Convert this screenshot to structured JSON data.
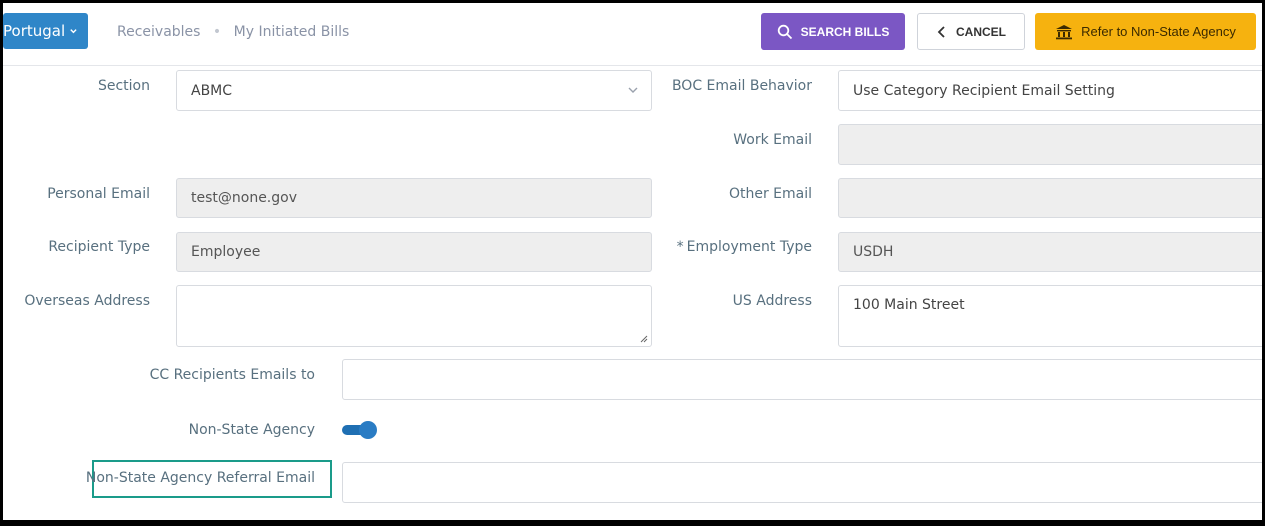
{
  "topbar": {
    "country": "Portugal",
    "breadcrumb": [
      "Receivables",
      "My Initiated Bills"
    ],
    "search_label": "SEARCH BILLS",
    "cancel_label": "CANCEL",
    "refer_label": "Refer to Non-State Agency"
  },
  "colors": {
    "country_button": "#2f86c8",
    "search_button": "#7b57c4",
    "refer_button": "#f6b20f",
    "label": "#58707f",
    "toggle_on": "#1f6fb3",
    "highlight_border": "#1a9b8a"
  },
  "form": {
    "section": {
      "label": "Section",
      "value": "ABMC"
    },
    "boc_email_behavior": {
      "label": "BOC Email Behavior",
      "value": "Use Category Recipient Email Setting"
    },
    "work_email": {
      "label": "Work Email",
      "value": ""
    },
    "personal_email": {
      "label": "Personal Email",
      "value": "test@none.gov"
    },
    "other_email": {
      "label": "Other Email",
      "value": ""
    },
    "recipient_type": {
      "label": "Recipient Type",
      "value": "Employee"
    },
    "employment_type": {
      "label": "Employment Type",
      "required_marker": "*",
      "value": "USDH"
    },
    "overseas_address": {
      "label": "Overseas Address",
      "value": ""
    },
    "us_address": {
      "label": "US Address",
      "value": "100 Main Street"
    },
    "cc_recipients": {
      "label": "CC Recipients Emails to",
      "value": ""
    },
    "non_state_agency": {
      "label": "Non-State Agency",
      "enabled": true
    },
    "referral_email": {
      "label": "Non-State Agency Referral Email",
      "value": ""
    }
  }
}
